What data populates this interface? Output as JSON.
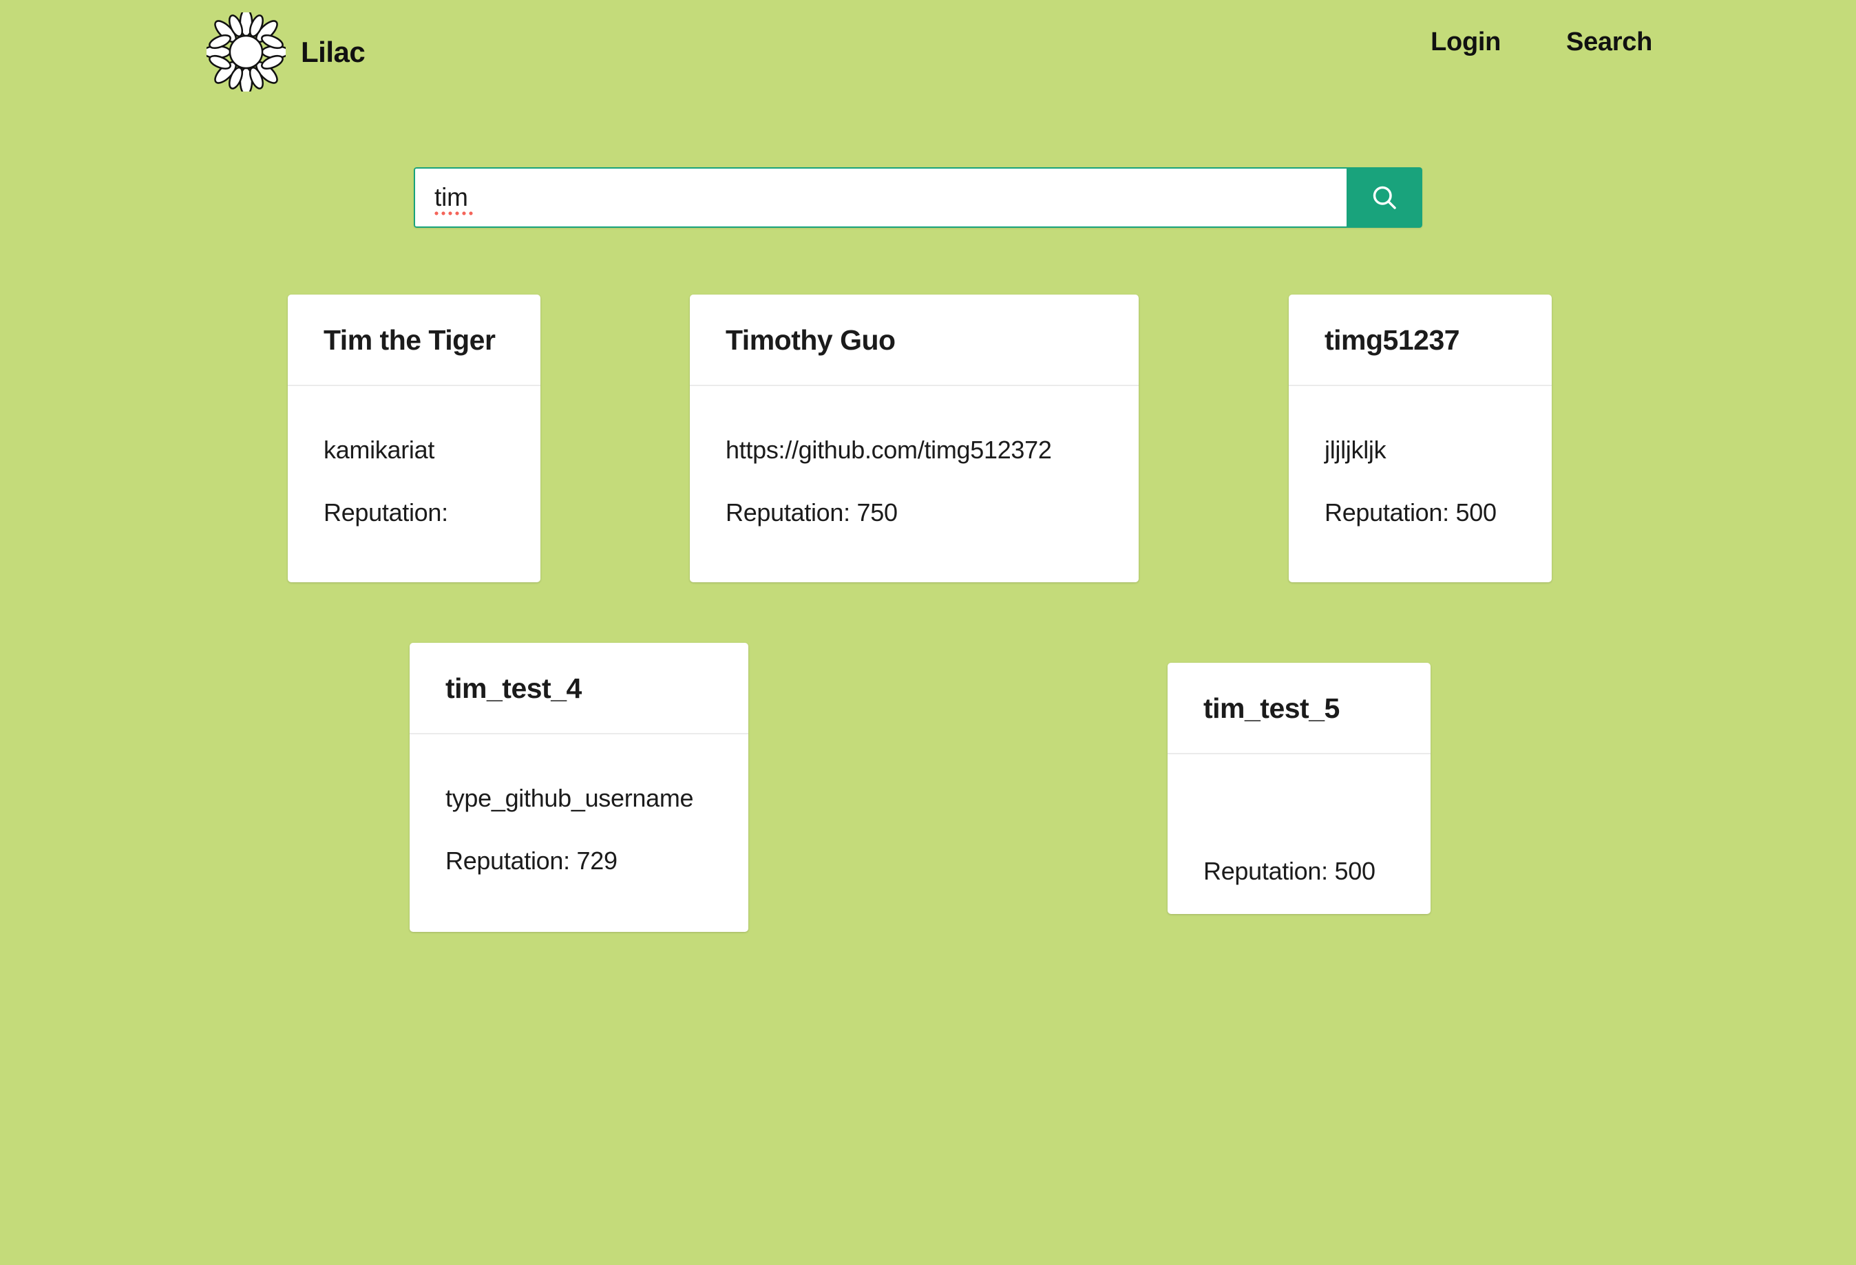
{
  "theme": {
    "background": "#c4db7a",
    "accent": "#19a37c",
    "card_background": "#ffffff",
    "text": "#1b1b1b",
    "divider": "#ebebeb",
    "spellcheck_underline": "#f4645a"
  },
  "header": {
    "brand_name": "Lilac",
    "logo_icon": "flower-logo-icon",
    "nav": [
      {
        "label": "Login",
        "name": "nav-link-login"
      },
      {
        "label": "Search",
        "name": "nav-link-search"
      }
    ]
  },
  "search": {
    "value": "tim",
    "placeholder": "",
    "button_icon": "search-icon",
    "spellcheck_flagged": true
  },
  "results": {
    "count": 5,
    "reputation_label": "Reputation:",
    "cards": [
      {
        "title": "Tim the Tiger",
        "username": "kamikariat",
        "reputation_text": "Reputation:",
        "reputation_value": ""
      },
      {
        "title": "Timothy Guo",
        "username": "https://github.com/timg512372",
        "reputation_text": "Reputation: 750",
        "reputation_value": "750"
      },
      {
        "title": "timg51237",
        "username": "jljljkljk",
        "reputation_text": "Reputation: 500",
        "reputation_value": "500"
      },
      {
        "title": "tim_test_4",
        "username": "type_github_username",
        "reputation_text": "Reputation: 729",
        "reputation_value": "729"
      },
      {
        "title": "tim_test_5",
        "username": "",
        "reputation_text": "Reputation: 500",
        "reputation_value": "500"
      }
    ]
  }
}
